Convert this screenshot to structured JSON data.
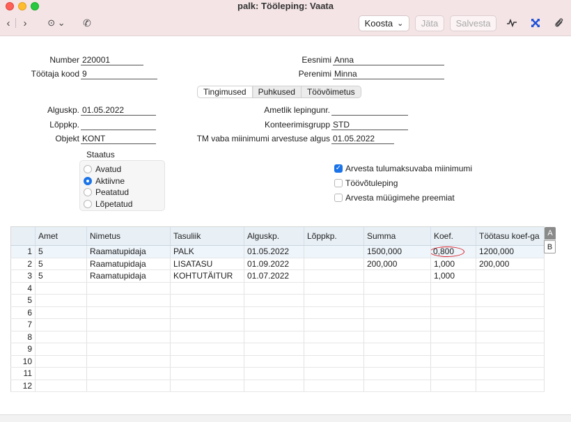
{
  "window": {
    "title": "palk: Tööleping: Vaata",
    "buttons": {
      "koosta": "Koosta",
      "jata": "Jäta",
      "salvesta": "Salvesta"
    },
    "icons": {
      "back": "‹",
      "forward": "›",
      "more": "⊙ ⌄",
      "phone": "✆",
      "activity": "∿",
      "expand": "✕",
      "attach": "⌇"
    },
    "koosta_chevron": "⌄"
  },
  "form": {
    "number": {
      "label": "Number",
      "value": "220001"
    },
    "tootaja_kood": {
      "label": "Töötaja kood",
      "value": "9"
    },
    "eesnimi": {
      "label": "Eesnimi",
      "value": "Anna"
    },
    "perenimi": {
      "label": "Perenimi",
      "value": "Minna"
    },
    "tabs": [
      "Tingimused",
      "Puhkused",
      "Töövõimetus"
    ],
    "alguskp": {
      "label": "Alguskp.",
      "value": "01.05.2022"
    },
    "loppkp": {
      "label": "Lõppkp.",
      "value": ""
    },
    "objekt": {
      "label": "Objekt",
      "value": "KONT"
    },
    "ametlik": {
      "label": "Ametlik lepingunr.",
      "value": ""
    },
    "konteerimisgrupp": {
      "label": "Konteerimisgrupp",
      "value": "STD"
    },
    "tm_vaba": {
      "label": "TM vaba miinimumi arvestuse algus",
      "value": "01.05.2022"
    },
    "statuus": {
      "label": "Staatus",
      "options": [
        "Avatud",
        "Aktiivne",
        "Peatatud",
        "Lõpetatud"
      ],
      "selected": "Aktiivne"
    },
    "checkboxes": [
      {
        "label": "Arvesta tulumaksuvaba miinimumi",
        "checked": true
      },
      {
        "label": "Töövõtuleping",
        "checked": false
      },
      {
        "label": "Arvesta müügimehe preemiat",
        "checked": false
      }
    ]
  },
  "grid": {
    "columns": [
      "",
      "Amet",
      "Nimetus",
      "Tasuliik",
      "Alguskp.",
      "Lõppkp.",
      "Summa",
      "Koef.",
      "Töötasu koef-ga"
    ],
    "rows": [
      [
        "1",
        "5",
        "Raamatupidaja",
        "PALK",
        "01.05.2022",
        "",
        "1500,000",
        "0,800",
        "1200,000"
      ],
      [
        "2",
        "5",
        "Raamatupidaja",
        "LISATASU",
        "01.09.2022",
        "",
        "200,000",
        "1,000",
        "200,000"
      ],
      [
        "3",
        "5",
        "Raamatupidaja",
        "KOHTUTÄITUR",
        "01.07.2022",
        "",
        "",
        "1,000",
        ""
      ],
      [
        "4",
        "",
        "",
        "",
        "",
        "",
        "",
        "",
        ""
      ],
      [
        "5",
        "",
        "",
        "",
        "",
        "",
        "",
        "",
        ""
      ],
      [
        "6",
        "",
        "",
        "",
        "",
        "",
        "",
        "",
        ""
      ],
      [
        "7",
        "",
        "",
        "",
        "",
        "",
        "",
        "",
        ""
      ],
      [
        "8",
        "",
        "",
        "",
        "",
        "",
        "",
        "",
        ""
      ],
      [
        "9",
        "",
        "",
        "",
        "",
        "",
        "",
        "",
        ""
      ],
      [
        "10",
        "",
        "",
        "",
        "",
        "",
        "",
        "",
        ""
      ],
      [
        "11",
        "",
        "",
        "",
        "",
        "",
        "",
        "",
        ""
      ],
      [
        "12",
        "",
        "",
        "",
        "",
        "",
        "",
        "",
        ""
      ]
    ],
    "selected_row": 1,
    "highlighted_cell": {
      "row": 1,
      "column": "Koef."
    },
    "side_tabs": [
      "A",
      "B"
    ]
  },
  "colors": {
    "titlebar": "#f4e4e6",
    "accent": "#1a73e8",
    "highlight_circle": "#d8232a"
  }
}
